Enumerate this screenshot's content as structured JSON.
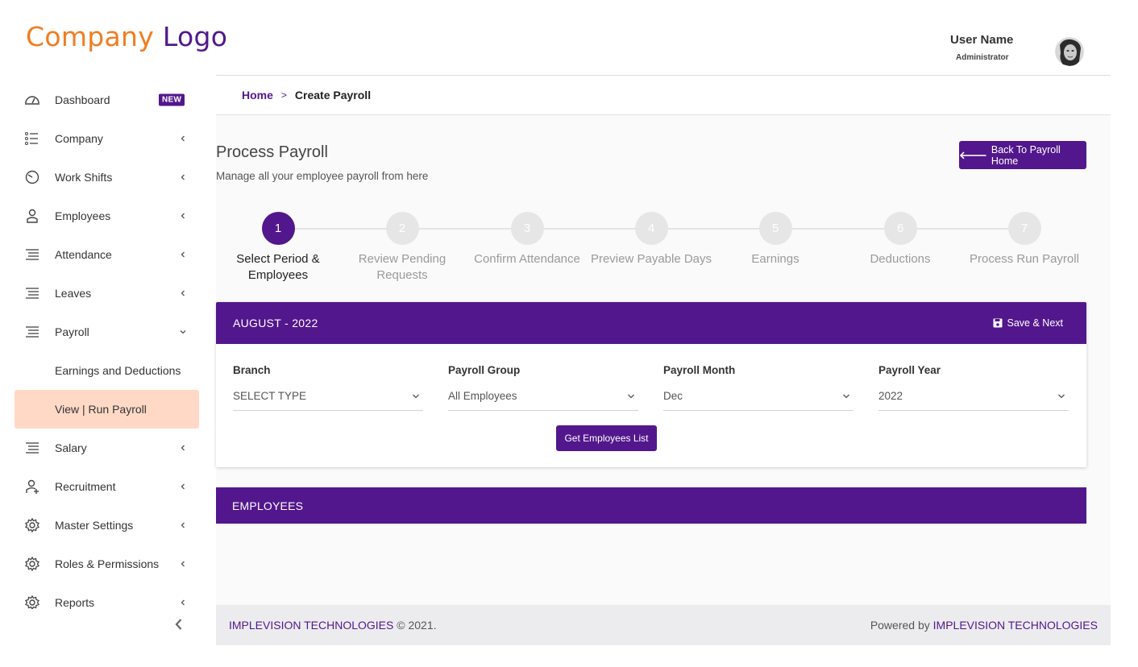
{
  "logo": {
    "part1": "Company",
    "part2": "Logo"
  },
  "header": {
    "user_name": "User Name",
    "user_role": "Administrator"
  },
  "sidebar": {
    "items": [
      {
        "label": "Dashboard",
        "icon": "dashboard-icon",
        "badge": "NEW"
      },
      {
        "label": "Company",
        "icon": "list-icon"
      },
      {
        "label": "Work Shifts",
        "icon": "clock-icon"
      },
      {
        "label": "Employees",
        "icon": "user-icon"
      },
      {
        "label": "Attendance",
        "icon": "lines-icon"
      },
      {
        "label": "Leaves",
        "icon": "lines-icon"
      },
      {
        "label": "Payroll",
        "icon": "lines-icon",
        "expanded": true,
        "children": [
          {
            "label": "Earnings and Deductions"
          },
          {
            "label": "View | Run Payroll",
            "active": true
          }
        ]
      },
      {
        "label": "Salary",
        "icon": "lines-icon"
      },
      {
        "label": "Recruitment",
        "icon": "user-plus-icon"
      },
      {
        "label": "Master Settings",
        "icon": "gear-icon"
      },
      {
        "label": "Roles & Permissions",
        "icon": "gear-icon"
      },
      {
        "label": "Reports",
        "icon": "gear-icon"
      }
    ]
  },
  "breadcrumb": {
    "home": "Home",
    "separator": ">",
    "current": "Create Payroll"
  },
  "page": {
    "title": "Process Payroll",
    "subtitle": "Manage all your employee payroll from here",
    "back_button": "Back To Payroll Home"
  },
  "stepper": {
    "steps": [
      {
        "number": "1",
        "label": "Select Period & Employees",
        "active": true
      },
      {
        "number": "2",
        "label": "Review Pending Requests"
      },
      {
        "number": "3",
        "label": "Confirm Attendance"
      },
      {
        "number": "4",
        "label": "Preview Payable Days"
      },
      {
        "number": "5",
        "label": "Earnings"
      },
      {
        "number": "6",
        "label": "Deductions"
      },
      {
        "number": "7",
        "label": "Process Run Payroll"
      }
    ]
  },
  "card": {
    "period": "AUGUST - 2022",
    "save_next": "Save & Next",
    "fields": [
      {
        "label": "Branch",
        "value": "SELECT TYPE"
      },
      {
        "label": "Payroll Group",
        "value": "All Employees"
      },
      {
        "label": "Payroll Month",
        "value": "Dec"
      },
      {
        "label": "Payroll Year",
        "value": "2022"
      }
    ],
    "get_button": "Get Employees List"
  },
  "employees": {
    "title": "EMPLOYEES"
  },
  "footer": {
    "left_brand": "IMPLEVISION TECHNOLOGIES",
    "left_suffix": "© 2021.",
    "right_prefix": "Powered by",
    "right_brand": "IMPLEVISION TECHNOLOGIES"
  },
  "colors": {
    "primary": "#52178d",
    "accent": "#f07d22",
    "active_bg": "#ffd9c6"
  }
}
